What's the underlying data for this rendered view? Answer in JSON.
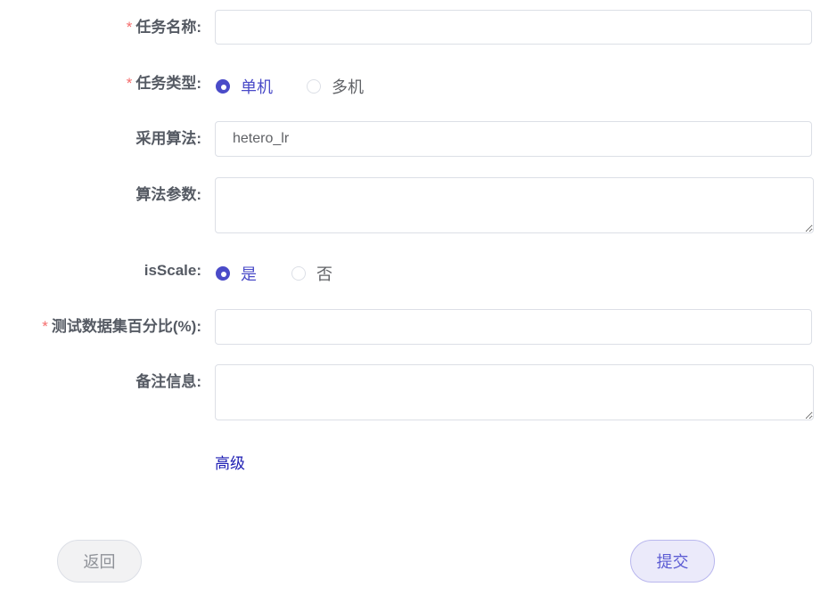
{
  "form": {
    "task_name": {
      "label": "任务名称:",
      "required_mark": "*",
      "value": ""
    },
    "task_type": {
      "label": "任务类型:",
      "required_mark": "*",
      "options": [
        "单机",
        "多机"
      ],
      "selected": "单机"
    },
    "algorithm": {
      "label": "采用算法:",
      "value": "hetero_lr"
    },
    "algo_params": {
      "label": "算法参数:",
      "value": ""
    },
    "is_scale": {
      "label": "isScale:",
      "options": [
        "是",
        "否"
      ],
      "selected": "是"
    },
    "test_percent": {
      "label": "测试数据集百分比(%):",
      "required_mark": "*",
      "value": ""
    },
    "remarks": {
      "label": "备注信息:",
      "value": ""
    },
    "advanced_link": "高级"
  },
  "actions": {
    "back_label": "返回",
    "submit_label": "提交"
  },
  "colors": {
    "accent": "#4a4bc8",
    "required": "#f56c6c",
    "link": "#1d1db3"
  }
}
